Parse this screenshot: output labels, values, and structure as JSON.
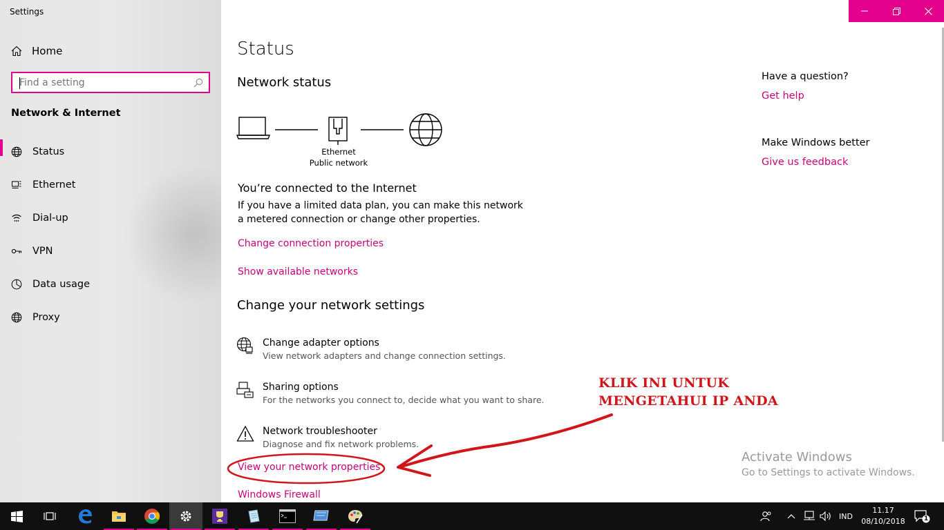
{
  "window": {
    "title": "Settings"
  },
  "sidebar": {
    "home_label": "Home",
    "search_placeholder": "Find a setting",
    "section_title": "Network & Internet",
    "items": [
      {
        "label": "Status",
        "icon": "globe-icon",
        "active": true
      },
      {
        "label": "Ethernet",
        "icon": "ethernet-icon"
      },
      {
        "label": "Dial-up",
        "icon": "dialup-icon"
      },
      {
        "label": "VPN",
        "icon": "vpn-icon"
      },
      {
        "label": "Data usage",
        "icon": "data-usage-icon"
      },
      {
        "label": "Proxy",
        "icon": "globe-icon"
      }
    ]
  },
  "main": {
    "title": "Status",
    "network_status_heading": "Network status",
    "diagram": {
      "adapter_name": "Ethernet",
      "network_type": "Public network"
    },
    "connected_heading": "You’re connected to the Internet",
    "connected_desc": "If you have a limited data plan, you can make this network a metered connection or change other properties.",
    "change_connection_link": "Change connection properties",
    "show_networks_link": "Show available networks",
    "change_settings_heading": "Change your network settings",
    "settings": [
      {
        "title": "Change adapter options",
        "desc": "View network adapters and change connection settings.",
        "icon": "adapter-globe-icon"
      },
      {
        "title": "Sharing options",
        "desc": "For the networks you connect to, decide what you want to share.",
        "icon": "sharing-icon"
      },
      {
        "title": "Network troubleshooter",
        "desc": "Diagnose and fix network problems.",
        "icon": "warning-icon"
      }
    ],
    "view_properties_link": "View your network properties",
    "firewall_link": "Windows Firewall"
  },
  "right": {
    "question": "Have a question?",
    "get_help": "Get help",
    "better": "Make Windows better",
    "feedback": "Give us feedback"
  },
  "watermark": {
    "line1": "Activate Windows",
    "line2": "Go to Settings to activate Windows."
  },
  "annotation": {
    "line1": "KLIK INI UNTUK",
    "line2": "MENGETAHUI IP ANDA",
    "color": "#d0151b"
  },
  "taskbar": {
    "language": "IND",
    "time": "11.17",
    "date": "08/10/2018",
    "notification_count": "1",
    "apps": [
      "start-icon",
      "task-view-icon",
      "edge-icon",
      "file-explorer-icon",
      "chrome-icon",
      "settings-icon",
      "trophy-app-icon",
      "notepad-app-icon",
      "terminal-icon",
      "monitor-app-icon",
      "paint-icon"
    ]
  },
  "colors": {
    "accent": "#e3008c",
    "link": "#c8007a",
    "taskbar": "#101010"
  }
}
